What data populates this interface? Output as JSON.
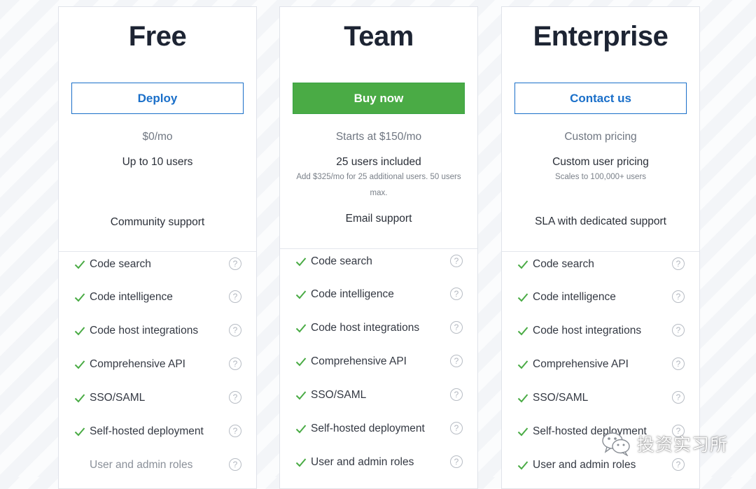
{
  "plans": [
    {
      "title": "Free",
      "cta_label": "Deploy",
      "price": "$0/mo",
      "users": "Up to 10 users",
      "note": "",
      "support": "Community support",
      "features": [
        {
          "label": "Code search",
          "included": true
        },
        {
          "label": "Code intelligence",
          "included": true
        },
        {
          "label": "Code host integrations",
          "included": true
        },
        {
          "label": "Comprehensive API",
          "included": true
        },
        {
          "label": "SSO/SAML",
          "included": true
        },
        {
          "label": "Self-hosted deployment",
          "included": true
        },
        {
          "label": "User and admin roles",
          "included": false
        }
      ]
    },
    {
      "title": "Team",
      "cta_label": "Buy now",
      "price": "Starts at $150/mo",
      "users": "25 users included",
      "note": "Add $325/mo for 25 additional users. 50 users max.",
      "support": "Email support",
      "features": [
        {
          "label": "Code search",
          "included": true
        },
        {
          "label": "Code intelligence",
          "included": true
        },
        {
          "label": "Code host integrations",
          "included": true
        },
        {
          "label": "Comprehensive API",
          "included": true
        },
        {
          "label": "SSO/SAML",
          "included": true
        },
        {
          "label": "Self-hosted deployment",
          "included": true
        },
        {
          "label": "User and admin roles",
          "included": true
        }
      ]
    },
    {
      "title": "Enterprise",
      "cta_label": "Contact us",
      "price": "Custom pricing",
      "users": "Custom user pricing",
      "note": "Scales to 100,000+ users",
      "support": "SLA with dedicated support",
      "features": [
        {
          "label": "Code search",
          "included": true
        },
        {
          "label": "Code intelligence",
          "included": true
        },
        {
          "label": "Code host integrations",
          "included": true
        },
        {
          "label": "Comprehensive API",
          "included": true
        },
        {
          "label": "SSO/SAML",
          "included": true
        },
        {
          "label": "Self-hosted deployment",
          "included": true
        },
        {
          "label": "User and admin roles",
          "included": true
        }
      ]
    }
  ],
  "help_glyph": "?",
  "icons": {
    "feature": "check-icon",
    "help": "help-circle-icon",
    "watermark": "wechat-logo-icon"
  },
  "colors": {
    "accent_blue": "#1a6fc9",
    "buy_green": "#4aab45",
    "check_green": "#4aab45"
  },
  "watermark_text": "投资实习所"
}
